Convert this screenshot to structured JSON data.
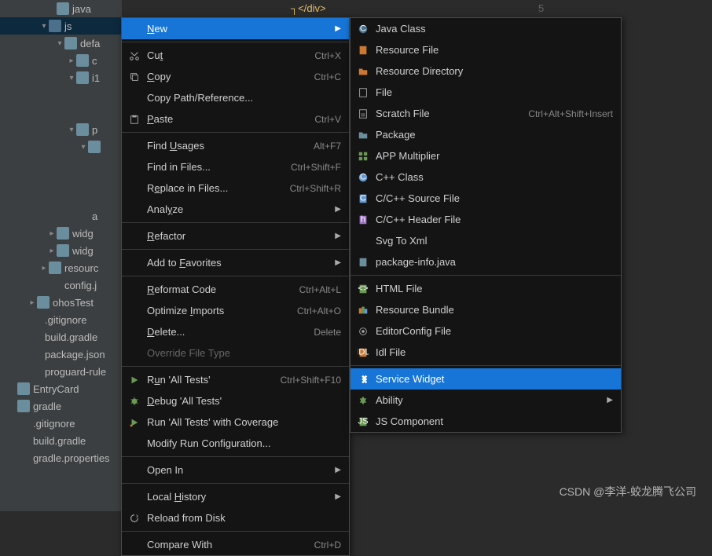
{
  "editor": {
    "line_num": "5",
    "code": "</div>"
  },
  "tree": {
    "items": [
      {
        "indent": 60,
        "arrow": "",
        "icon": "folder",
        "label": "java"
      },
      {
        "indent": 50,
        "arrow": "▾",
        "icon": "folder-dark",
        "label": "js",
        "sel": true
      },
      {
        "indent": 70,
        "arrow": "▾",
        "icon": "folder",
        "label": "defa"
      },
      {
        "indent": 85,
        "arrow": "▸",
        "icon": "folder",
        "label": "c"
      },
      {
        "indent": 85,
        "arrow": "▾",
        "icon": "folder",
        "label": "i1"
      },
      {
        "indent": 100,
        "arrow": "",
        "icon": "file-g",
        "label": ""
      },
      {
        "indent": 100,
        "arrow": "",
        "icon": "file-g",
        "label": ""
      },
      {
        "indent": 85,
        "arrow": "▾",
        "icon": "folder",
        "label": "p"
      },
      {
        "indent": 100,
        "arrow": "▾",
        "icon": "folder",
        "label": ""
      },
      {
        "indent": 100,
        "arrow": "",
        "icon": "",
        "label": ""
      },
      {
        "indent": 100,
        "arrow": "",
        "icon": "",
        "label": ""
      },
      {
        "indent": 100,
        "arrow": "",
        "icon": "",
        "label": ""
      },
      {
        "indent": 85,
        "arrow": "",
        "icon": "file-g",
        "label": "a"
      },
      {
        "indent": 60,
        "arrow": "▸",
        "icon": "folder",
        "label": "widg"
      },
      {
        "indent": 60,
        "arrow": "▸",
        "icon": "folder",
        "label": "widg"
      },
      {
        "indent": 50,
        "arrow": "▸",
        "icon": "folder",
        "label": "resourc"
      },
      {
        "indent": 50,
        "arrow": "",
        "icon": "file-g",
        "label": "config.j"
      },
      {
        "indent": 35,
        "arrow": "▸",
        "icon": "folder",
        "label": "ohosTest"
      },
      {
        "indent": 25,
        "arrow": "",
        "icon": "file-g",
        "label": ".gitignore"
      },
      {
        "indent": 25,
        "arrow": "",
        "icon": "file-g",
        "label": "build.gradle"
      },
      {
        "indent": 25,
        "arrow": "",
        "icon": "file-g",
        "label": "package.json"
      },
      {
        "indent": 25,
        "arrow": "",
        "icon": "file-g",
        "label": "proguard-rule"
      },
      {
        "indent": 10,
        "arrow": "",
        "icon": "folder",
        "label": "EntryCard"
      },
      {
        "indent": 10,
        "arrow": "",
        "icon": "folder",
        "label": "gradle"
      },
      {
        "indent": 10,
        "arrow": "",
        "icon": "file-g",
        "label": ".gitignore"
      },
      {
        "indent": 10,
        "arrow": "",
        "icon": "file-g",
        "label": "build.gradle"
      },
      {
        "indent": 10,
        "arrow": "",
        "icon": "file-g",
        "label": "gradle.properties"
      }
    ]
  },
  "menu": [
    {
      "label": "New",
      "u": 0,
      "hl": true,
      "sub": true
    },
    {
      "sep": true
    },
    {
      "icon": "cut",
      "label": "Cut",
      "u": 2,
      "shortcut": "Ctrl+X"
    },
    {
      "icon": "copy",
      "label": "Copy",
      "u": 0,
      "shortcut": "Ctrl+C"
    },
    {
      "label": "Copy Path/Reference..."
    },
    {
      "icon": "paste",
      "label": "Paste",
      "u": 0,
      "shortcut": "Ctrl+V"
    },
    {
      "sep": true
    },
    {
      "label": "Find Usages",
      "u": 5,
      "shortcut": "Alt+F7"
    },
    {
      "label": "Find in Files...",
      "shortcut": "Ctrl+Shift+F"
    },
    {
      "label": "Replace in Files...",
      "u": 1,
      "shortcut": "Ctrl+Shift+R"
    },
    {
      "label": "Analyze",
      "u": 4,
      "sub": true
    },
    {
      "sep": true
    },
    {
      "label": "Refactor",
      "u": 0,
      "sub": true
    },
    {
      "sep": true
    },
    {
      "label": "Add to Favorites",
      "u": 7,
      "sub": true
    },
    {
      "sep": true
    },
    {
      "label": "Reformat Code",
      "u": 0,
      "shortcut": "Ctrl+Alt+L"
    },
    {
      "label": "Optimize Imports",
      "u": 9,
      "shortcut": "Ctrl+Alt+O"
    },
    {
      "label": "Delete...",
      "u": 0,
      "shortcut": "Delete"
    },
    {
      "label": "Override File Type",
      "disabled": true
    },
    {
      "sep": true
    },
    {
      "icon": "run",
      "label": "Run 'All Tests'",
      "u": 1,
      "shortcut": "Ctrl+Shift+F10"
    },
    {
      "icon": "debug",
      "label": "Debug 'All Tests'",
      "u": 0
    },
    {
      "icon": "cover",
      "label": "Run 'All Tests' with Coverage"
    },
    {
      "label": "Modify Run Configuration..."
    },
    {
      "sep": true
    },
    {
      "label": "Open In",
      "sub": true
    },
    {
      "sep": true
    },
    {
      "label": "Local History",
      "u": 6,
      "sub": true
    },
    {
      "icon": "reload",
      "label": "Reload from Disk"
    },
    {
      "sep": true
    },
    {
      "label": "Compare With",
      "shortcut": "Ctrl+D"
    }
  ],
  "submenu": [
    {
      "icon": "jclass",
      "label": "Java Class"
    },
    {
      "icon": "rfile",
      "label": "Resource File"
    },
    {
      "icon": "rdir",
      "label": "Resource Directory"
    },
    {
      "icon": "file",
      "label": "File"
    },
    {
      "icon": "scratch",
      "label": "Scratch File",
      "shortcut": "Ctrl+Alt+Shift+Insert"
    },
    {
      "icon": "pkg",
      "label": "Package"
    },
    {
      "icon": "app",
      "label": "APP Multiplier"
    },
    {
      "icon": "cpp",
      "label": "C++ Class"
    },
    {
      "icon": "cfile",
      "label": "C/C++ Source File"
    },
    {
      "icon": "hfile",
      "label": "C/C++ Header File"
    },
    {
      "label": "Svg To Xml"
    },
    {
      "icon": "pkginfo",
      "label": "package-info.java"
    },
    {
      "sep": true
    },
    {
      "icon": "html",
      "label": "HTML File"
    },
    {
      "icon": "bundle",
      "label": "Resource Bundle"
    },
    {
      "icon": "edconf",
      "label": "EditorConfig File"
    },
    {
      "icon": "idl",
      "label": "Idl File"
    },
    {
      "sep": true
    },
    {
      "icon": "widget",
      "label": "Service Widget",
      "hl": true
    },
    {
      "icon": "ability",
      "label": "Ability",
      "sub": true
    },
    {
      "icon": "jscomp",
      "label": "JS Component"
    }
  ],
  "watermark": "CSDN @李洋-蛟龙腾飞公司"
}
